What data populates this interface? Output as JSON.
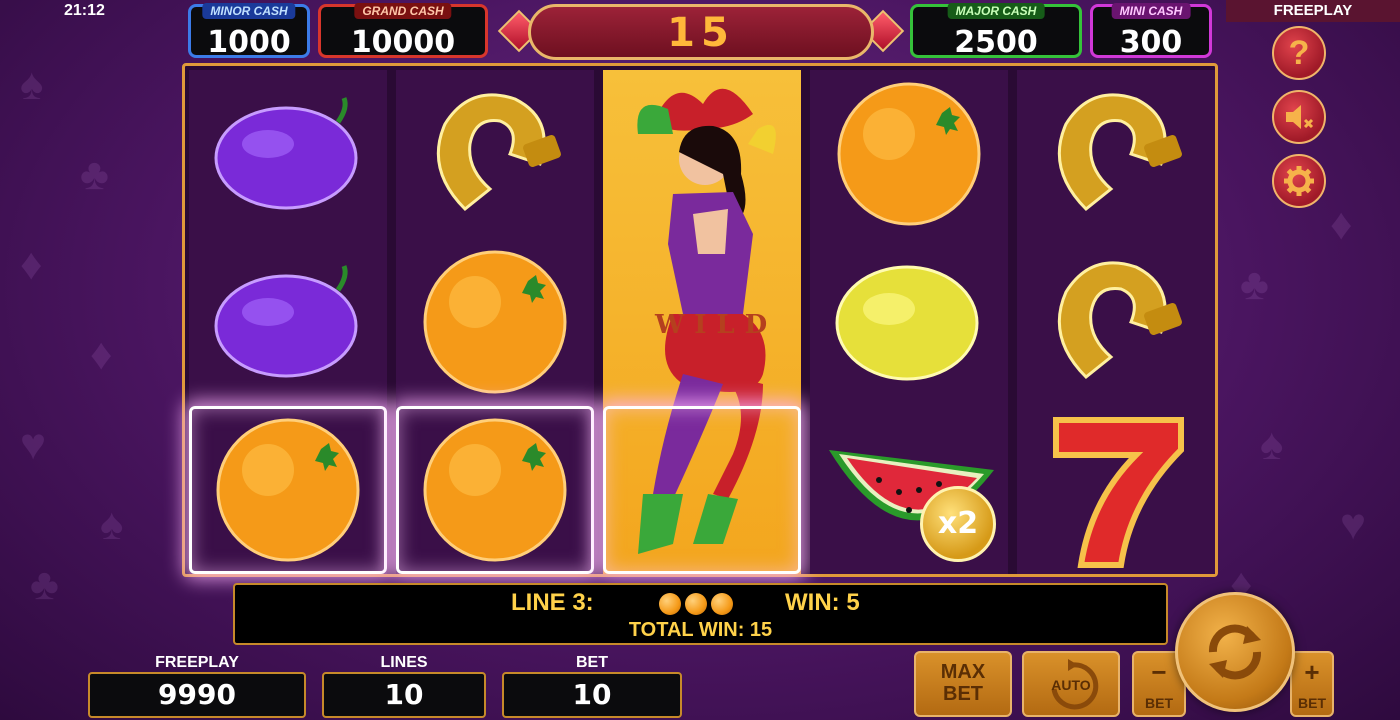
{
  "status": {
    "clock": "21:12",
    "mode": "FREEPLAY"
  },
  "jackpots": [
    {
      "name": "MINOR",
      "suffix": "CASH",
      "value": "1000",
      "color": "#3c7be8"
    },
    {
      "name": "GRAND",
      "suffix": "CASH",
      "value": "10000",
      "color": "#d8362c"
    },
    {
      "name": "MAJOR",
      "suffix": "CASH",
      "value": "2500",
      "color": "#35c23a"
    },
    {
      "name": "MINI",
      "suffix": "CASH",
      "value": "300",
      "color": "#d138d8"
    }
  ],
  "free_games_counter": "15",
  "reels": [
    [
      "plum",
      "plum",
      "orange"
    ],
    [
      "horseshoe",
      "orange",
      "orange"
    ],
    [
      "wild-jester",
      "wild-jester",
      "wild-jester"
    ],
    [
      "orange",
      "lemon",
      "watermelon"
    ],
    [
      "horseshoe",
      "horseshoe",
      "seven"
    ]
  ],
  "winning_cells": [
    [
      0,
      2
    ],
    [
      1,
      2
    ],
    [
      2,
      2
    ]
  ],
  "wild_label": "WILD",
  "multiplier_badge": "x2",
  "win_info": {
    "line_label": "LINE 3:",
    "win_label": "WIN: 5",
    "total_win": "TOTAL WIN: 15",
    "symbol_icon": "orange-ball-icon"
  },
  "stats": {
    "freeplay_label": "FREEPLAY",
    "freeplay_value": "9990",
    "lines_label": "LINES",
    "lines_value": "10",
    "bet_label": "BET",
    "bet_value": "10"
  },
  "controls": {
    "max_bet": [
      "MAX",
      "BET"
    ],
    "auto": "AUTO",
    "bet_minus_sign": "−",
    "bet_minus_label": "BET",
    "bet_plus_sign": "+",
    "bet_plus_label": "BET",
    "help": "?"
  },
  "colors": {
    "accent_gold": "#e09a3a",
    "win_text": "#ffd24a",
    "background": "#4a1560"
  }
}
